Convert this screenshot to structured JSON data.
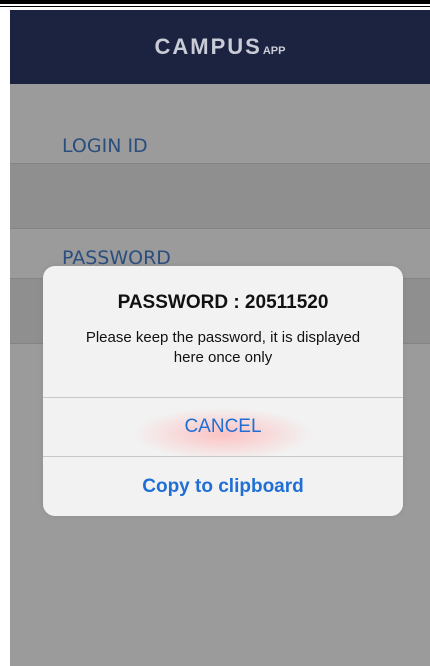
{
  "header": {
    "logo_main": "CAMPUS",
    "logo_sub": "APP"
  },
  "form": {
    "login_label": "LOGIN ID",
    "password_label": "PASSWORD"
  },
  "dialog": {
    "title": "PASSWORD : 20511520",
    "message": "Please keep the password, it is displayed here once only",
    "cancel_label": "CANCEL",
    "copy_label": "Copy to clipboard"
  },
  "colors": {
    "header_bg": "#1c2340",
    "accent": "#1f6fd6",
    "label_text": "#2a4e7e",
    "overlay_bg": "#9b9b9b"
  }
}
